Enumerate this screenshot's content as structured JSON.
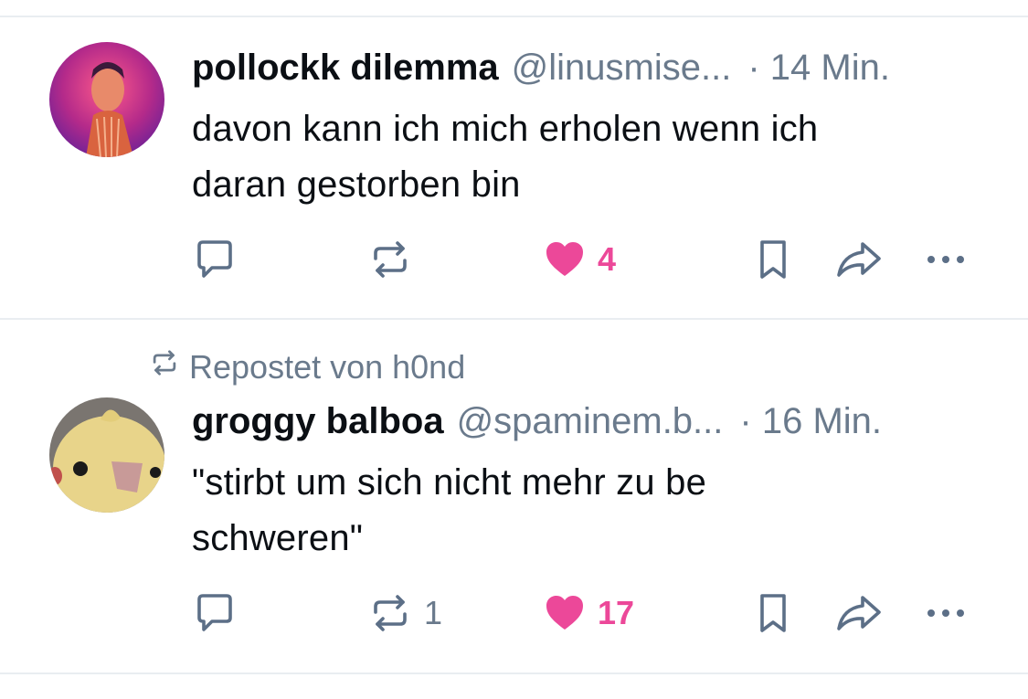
{
  "posts": [
    {
      "author": "pollockk dilemma",
      "handle": "@linusmise...",
      "time": "· 14 Min.",
      "text_lines": [
        "davon kann ich mich erholen wenn ich",
        "daran gestorben bin"
      ],
      "reply_count": "",
      "repost_count": "",
      "like_count": "4"
    },
    {
      "reposted_by": "Repostet von h0nd",
      "author": "groggy balboa",
      "handle": "@spaminem.b...",
      "time": "· 16 Min.",
      "text_lines": [
        "\"stirbt um sich nicht mehr zu be",
        "schweren\""
      ],
      "reply_count": "",
      "repost_count": "1",
      "like_count": "17"
    }
  ],
  "colors": {
    "like": "#ec4899",
    "icon": "#5c6f87",
    "muted": "#6a7a8c",
    "divider": "#e9edf1"
  },
  "icons": [
    "reply-icon",
    "repost-icon",
    "heart-icon",
    "bookmark-icon",
    "share-icon",
    "more-icon"
  ]
}
